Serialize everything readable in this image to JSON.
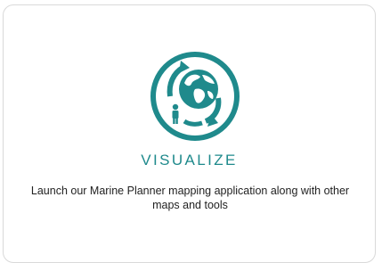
{
  "card": {
    "icon": "globe-cycle-person-icon",
    "title": "VISUALIZE",
    "description": "Launch our Marine Planner mapping application along with other maps and tools"
  },
  "colors": {
    "accent": "#1f8a8c",
    "text": "#222222",
    "border": "#d9d9d9"
  }
}
